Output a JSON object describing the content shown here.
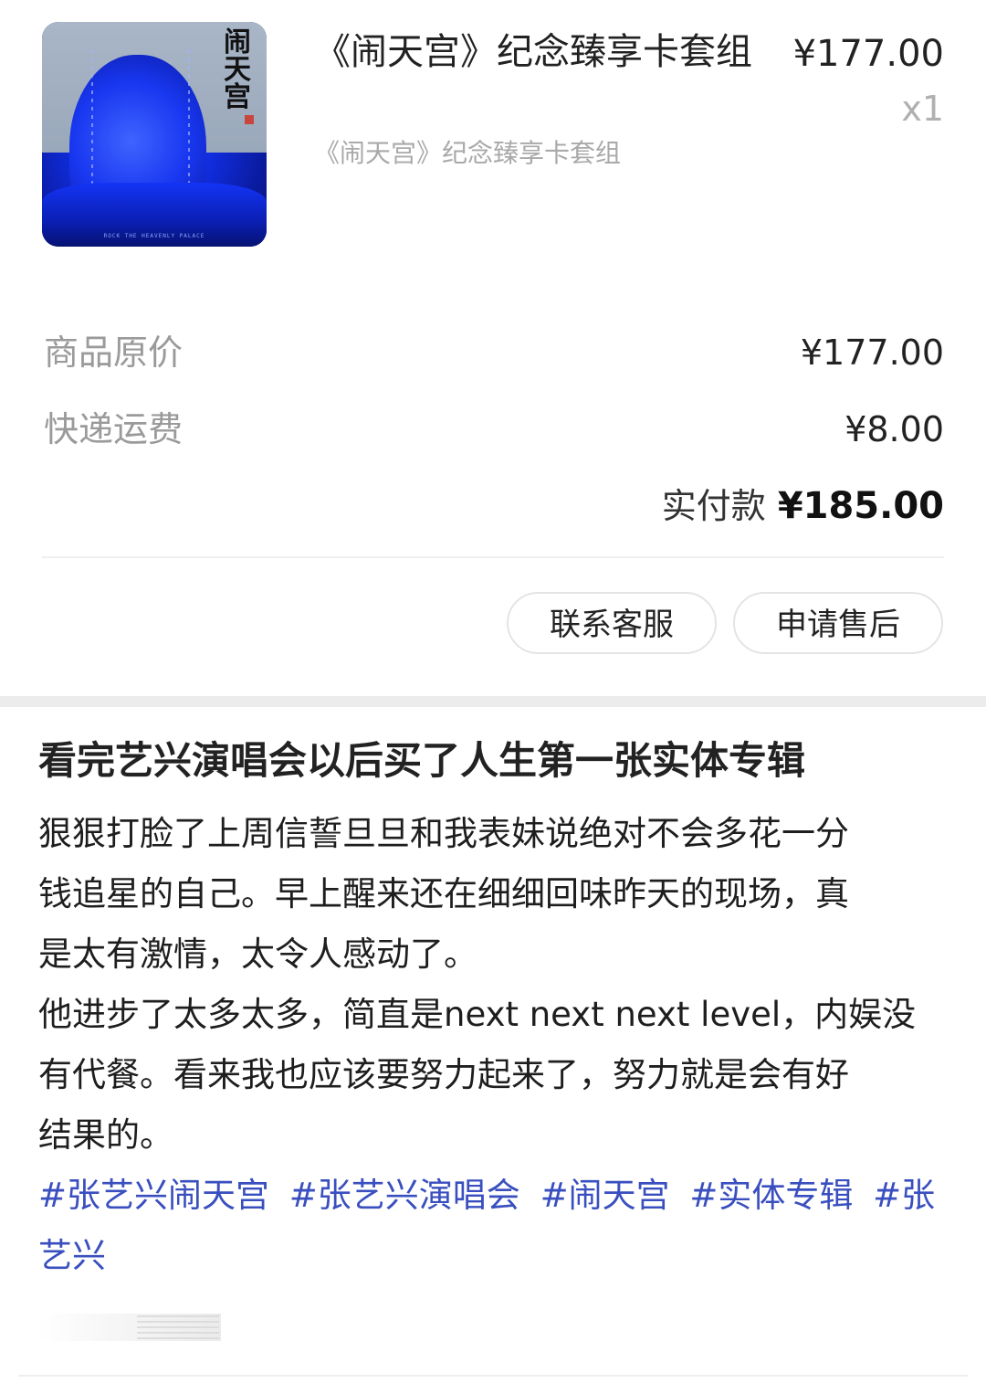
{
  "order": {
    "product": {
      "thumbnail": {
        "cover_title": "闹天宫",
        "cover_caption": "ROCK THE HEAVENLY PALACE"
      },
      "title": "《闹天宫》纪念臻享卡套组",
      "price": "¥177.00",
      "quantity": "x1",
      "spec": "《闹天宫》纪念臻享卡套组"
    },
    "summary": {
      "original_price_label": "商品原价",
      "original_price_value": "¥177.00",
      "shipping_label": "快递运费",
      "shipping_value": "¥8.00",
      "total_label": "实付款",
      "total_value": "¥185.00"
    },
    "actions": {
      "contact_label": "联系客服",
      "aftersale_label": "申请售后"
    }
  },
  "post": {
    "title": "看完艺兴演唱会以后买了人生第一张实体专辑",
    "body_lines": [
      "狠狠打脸了上周信誓旦旦和我表妹说绝对不会多花一分",
      "钱追星的自己。早上醒来还在细细回味昨天的现场，真",
      "是太有激情，太令人感动了。",
      "他进步了太多太多，简直是next next next level，内娱没",
      "有代餐。看来我也应该要努力起来了，努力就是会有好",
      "结果的。"
    ],
    "hashtags": [
      "#张艺兴闹天宫",
      "#张艺兴演唱会",
      "#闹天宫",
      "#实体专辑",
      "#张艺兴"
    ]
  },
  "colors": {
    "hashtag": "#3a4fbf",
    "muted_text": "#9a9a9a",
    "thumbnail_blue": "#1130e8"
  }
}
